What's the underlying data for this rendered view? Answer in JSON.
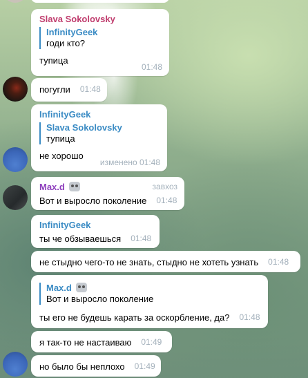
{
  "colors": {
    "name_slava": "#c03d6e",
    "name_infinitygeek": "#3a8bc4",
    "name_maxd": "#8e3fbd",
    "time": "#a3b0bb",
    "bubble": "#ffffff"
  },
  "messages": [
    {
      "sender": "Slava Sokolovsky",
      "reply": {
        "name": "InfinityGeek",
        "text": "годи кто?"
      },
      "text": "тупица",
      "time": "01:48"
    },
    {
      "text": "погугли",
      "time": "01:48"
    },
    {
      "sender": "InfinityGeek",
      "reply": {
        "name": "Slava Sokolovsky",
        "text": "тупица"
      },
      "text": "не хорошо",
      "time": "изменено 01:48"
    },
    {
      "sender": "Max.d",
      "sender_icon": "robot-icon",
      "badge": "завхоз",
      "text": "Вот и выросло поколение",
      "time": "01:48"
    },
    {
      "sender": "InfinityGeek",
      "text": "ты че обзываешься",
      "time": "01:48"
    },
    {
      "text": "не стыдно чего-то не знать, стыдно не хотеть узнать",
      "time": "01:48"
    },
    {
      "reply": {
        "name": "Max.d",
        "name_icon": "robot-icon",
        "text": "Вот и выросло поколение"
      },
      "text": "ты его не будешь карать за оскорбление, да?",
      "time": "01:48"
    },
    {
      "text": "я так-то не настаиваю",
      "time": "01:49"
    },
    {
      "text": "но было бы неплохо",
      "time": "01:49"
    }
  ]
}
